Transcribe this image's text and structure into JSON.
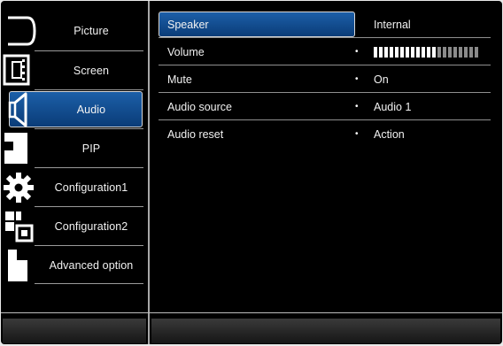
{
  "sidebar": {
    "items": [
      {
        "label": "Picture",
        "icon": "picture-icon"
      },
      {
        "label": "Screen",
        "icon": "screen-icon"
      },
      {
        "label": "Audio",
        "icon": "audio-icon",
        "selected": true
      },
      {
        "label": "PIP",
        "icon": "pip-icon"
      },
      {
        "label": "Configuration1",
        "icon": "gear-icon"
      },
      {
        "label": "Configuration2",
        "icon": "configuration2-icon"
      },
      {
        "label": "Advanced option",
        "icon": "advanced-option-icon"
      }
    ]
  },
  "settings": {
    "rows": [
      {
        "name": "Speaker",
        "value": "Internal",
        "selected": true
      },
      {
        "name": "Volume",
        "bullet": "•"
      },
      {
        "name": "Mute",
        "bullet": "•",
        "value": "On"
      },
      {
        "name": "Audio source",
        "bullet": "•",
        "value": "Audio 1"
      },
      {
        "name": "Audio reset",
        "bullet": "•",
        "value": "Action"
      }
    ],
    "volume": {
      "level": 12,
      "steps": 20
    }
  },
  "colors": {
    "highlight": "#0f4a8f",
    "volume_on": "#ffffff",
    "volume_off": "#8a8a8a"
  }
}
